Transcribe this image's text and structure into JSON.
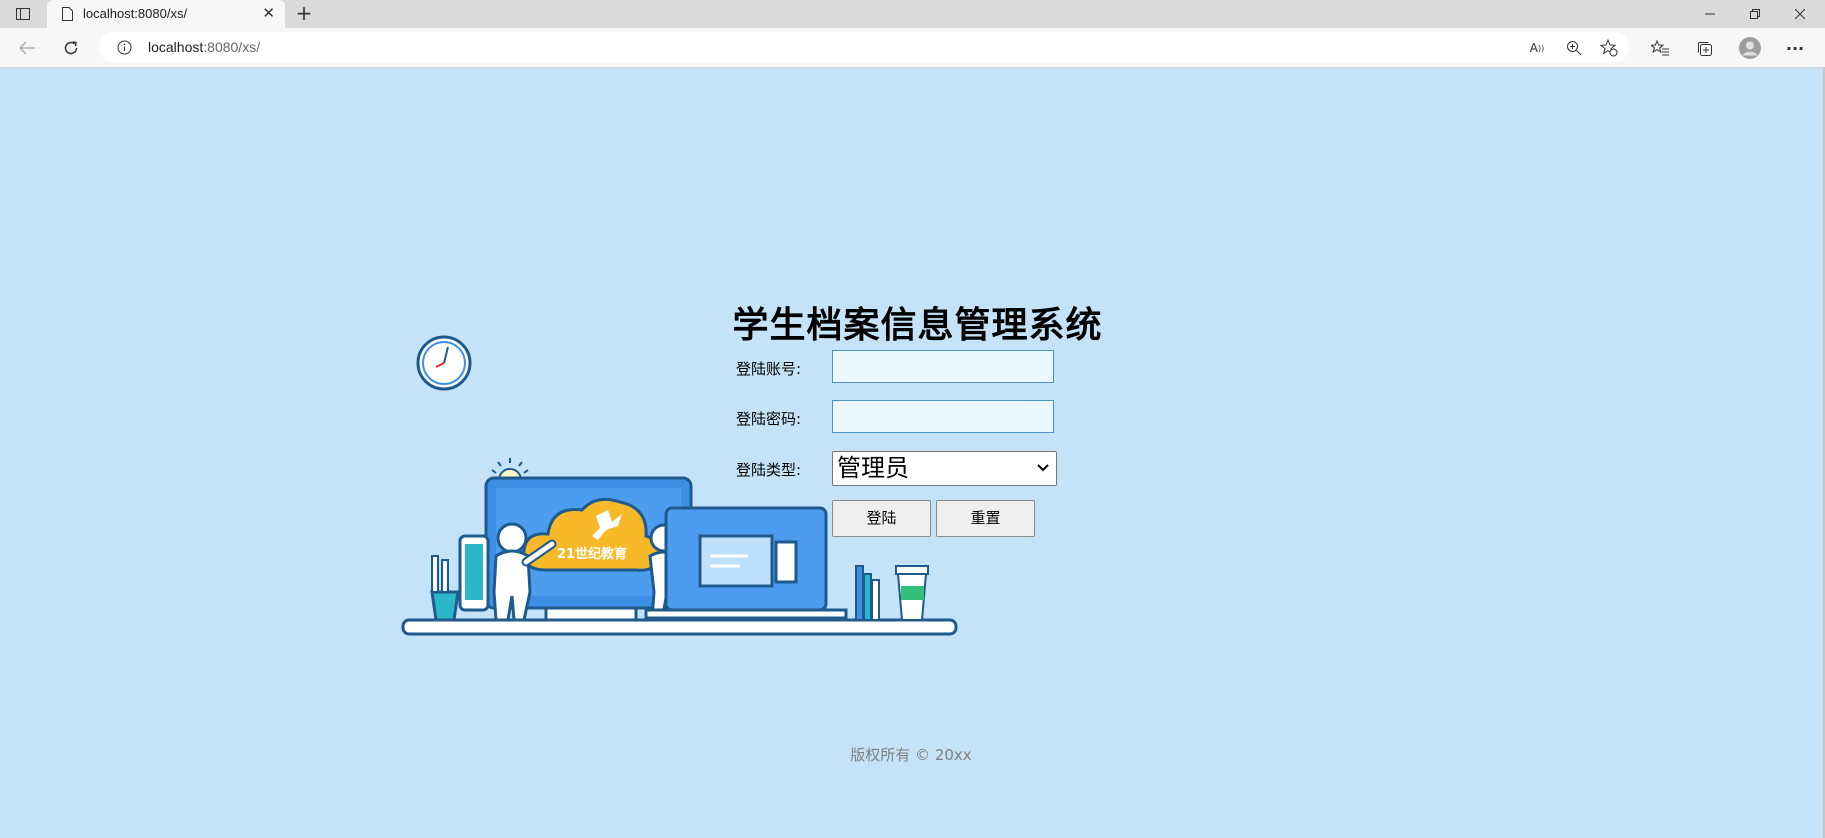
{
  "browser": {
    "tab_title": "localhost:8080/xs/",
    "url_host": "localhost",
    "url_rest": ":8080/xs/"
  },
  "page": {
    "title": "学生档案信息管理系统",
    "account_label": "登陆账号:",
    "account_value": "",
    "password_label": "登陆密码:",
    "password_value": "",
    "type_label": "登陆类型:",
    "type_selected": "管理员",
    "login_button": "登陆",
    "reset_button": "重置",
    "footer": "版权所有 © 20xx"
  },
  "illustration": {
    "brand_text": "21世纪教育"
  },
  "colors": {
    "page_bg": "#c5e3f8",
    "input_bg": "#eaf8fe",
    "accent_blue": "#3d8fe6",
    "cloud_yellow": "#f7b928"
  }
}
